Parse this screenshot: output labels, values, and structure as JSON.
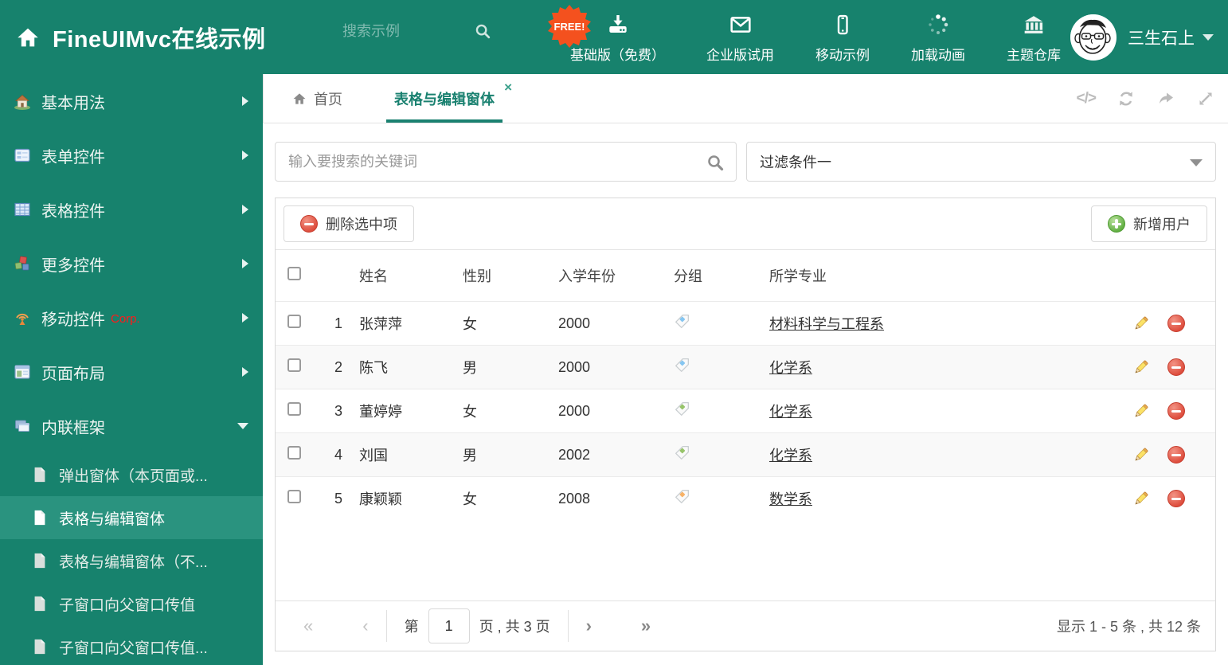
{
  "header": {
    "logo": "FineUIMvc在线示例",
    "search_placeholder": "搜索示例",
    "free_badge": "FREE!",
    "nav": [
      {
        "label": "基础版（免费）",
        "icon": "download-icon"
      },
      {
        "label": "企业版试用",
        "icon": "envelope-icon"
      },
      {
        "label": "移动示例",
        "icon": "phone-icon"
      },
      {
        "label": "加载动画",
        "icon": "spinner-icon"
      },
      {
        "label": "主题仓库",
        "icon": "bank-icon"
      }
    ],
    "user_name": "三生石上"
  },
  "sidebar": {
    "items": [
      {
        "label": "基本用法"
      },
      {
        "label": "表单控件"
      },
      {
        "label": "表格控件"
      },
      {
        "label": "更多控件"
      },
      {
        "label": "移动控件",
        "badge": "Corp."
      },
      {
        "label": "页面布局"
      },
      {
        "label": "内联框架"
      }
    ],
    "subitems": [
      {
        "label": "弹出窗体（本页面或..."
      },
      {
        "label": "表格与编辑窗体"
      },
      {
        "label": "表格与编辑窗体（不..."
      },
      {
        "label": "子窗口向父窗口传值"
      },
      {
        "label": "子窗口向父窗口传值..."
      }
    ]
  },
  "tabs": [
    {
      "label": "首页"
    },
    {
      "label": "表格与编辑窗体",
      "close": "×"
    }
  ],
  "filters": {
    "search_placeholder": "输入要搜索的关键词",
    "filter_selected": "过滤条件一"
  },
  "toolbar": {
    "delete_label": "删除选中项",
    "add_label": "新增用户"
  },
  "table": {
    "headers": [
      "姓名",
      "性别",
      "入学年份",
      "分组",
      "所学专业"
    ],
    "rows": [
      {
        "index": "1",
        "name": "张萍萍",
        "gender": "女",
        "year": "2000",
        "tag_color": "#86c6f1",
        "major": "材料科学与工程系"
      },
      {
        "index": "2",
        "name": "陈飞",
        "gender": "男",
        "year": "2000",
        "tag_color": "#86c6f1",
        "major": "化学系"
      },
      {
        "index": "3",
        "name": "董婷婷",
        "gender": "女",
        "year": "2000",
        "tag_color": "#97c46a",
        "major": "化学系"
      },
      {
        "index": "4",
        "name": "刘国",
        "gender": "男",
        "year": "2002",
        "tag_color": "#97c46a",
        "major": "化学系"
      },
      {
        "index": "5",
        "name": "康颖颖",
        "gender": "女",
        "year": "2008",
        "tag_color": "#f7b267",
        "major": "数学系"
      }
    ]
  },
  "pagination": {
    "first": "«",
    "prev": "‹",
    "page_prefix": "第",
    "page_value": "1",
    "page_suffix": "页 , 共 3 页",
    "next": "›",
    "last": "»",
    "summary": "显示 1 - 5 条 , 共 12 条"
  },
  "colors": {
    "accent": "#17826d",
    "sidebar_selected": "#2a937f",
    "free_badge": "#f4511e",
    "delete_red": "#dd4b3b",
    "add_green": "#5fae40"
  }
}
